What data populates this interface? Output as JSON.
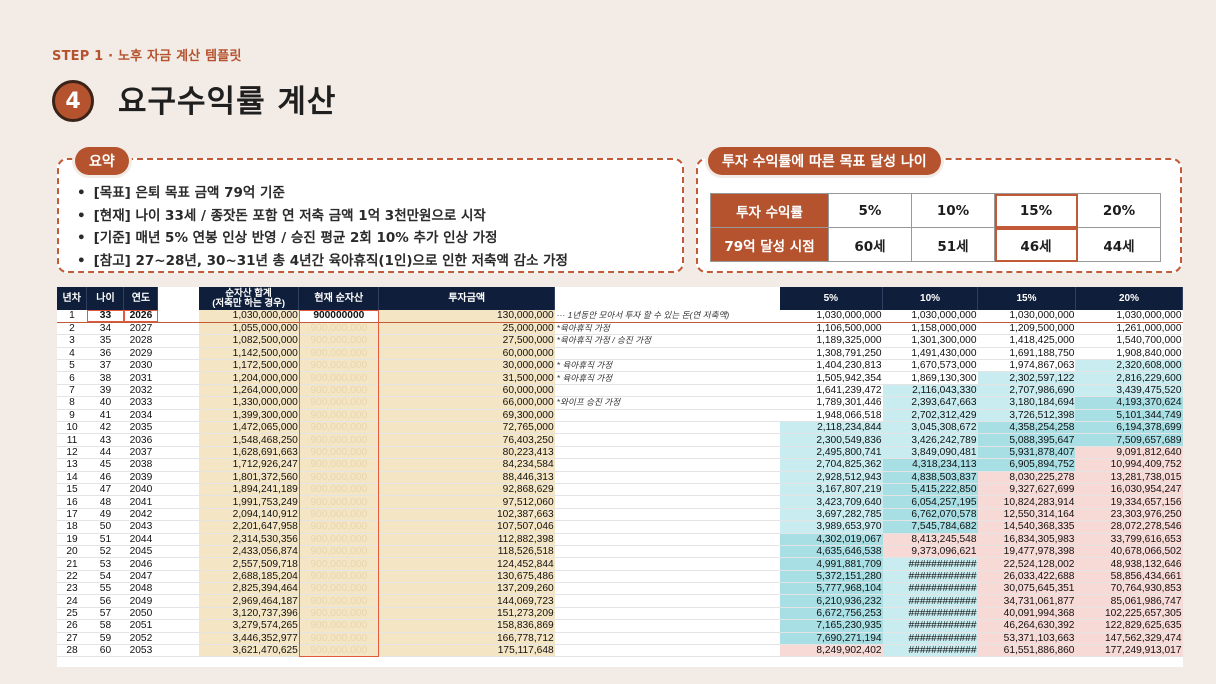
{
  "header": {
    "step": "STEP 1 · 노후 자금 계산 템플릿",
    "number": "4",
    "title": "요구수익률 계산"
  },
  "summary": {
    "label": "요약",
    "items": [
      "[목표] 은퇴 목표 금액 79억 기준",
      "[현재] 나이 33세 / 종잣돈 포함 연 저축 금액 1억 3천만원으로 시작",
      "[기준] 매년 5% 연봉 인상 반영 / 승진 평균 2회 10% 추가 인상 가정",
      "[참고] 27~28년, 30~31년 총 4년간 육아휴직(1인)으로 인한 저축액 감소 가정"
    ]
  },
  "target": {
    "label": "투자 수익률에 따른 목표 달성 나이",
    "row1_head": "투자 수익률",
    "row2_head": "79억 달성 시점",
    "rates": [
      "5%",
      "10%",
      "15%",
      "20%"
    ],
    "ages": [
      "60세",
      "51세",
      "46세",
      "44세"
    ],
    "highlight_index": 2
  },
  "sheet": {
    "headers": {
      "year_no": "년차",
      "age": "나이",
      "year": "연도",
      "net_sum": "순자산 합계\n(저축만 하는 경우)",
      "current": "현재 순자산",
      "invest": "투자금액",
      "r5": "5%",
      "r10": "10%",
      "r15": "15%",
      "r20": "20%"
    },
    "current_first": "900000000",
    "current_faded": "900,000,000",
    "rows": [
      [
        "1",
        "33",
        "2026",
        "1,030,000,000",
        "130,000,000",
        "··· 1년동안 모아서 투자 할 수 있는 돈(연 저축액)",
        "1,030,000,000",
        "1,030,000,000",
        "1,030,000,000",
        "1,030,000,000"
      ],
      [
        "2",
        "34",
        "2027",
        "1,055,000,000",
        "25,000,000",
        "*육아휴직 가정",
        "1,106,500,000",
        "1,158,000,000",
        "1,209,500,000",
        "1,261,000,000"
      ],
      [
        "3",
        "35",
        "2028",
        "1,082,500,000",
        "27,500,000",
        "*육아휴직 가정 / 승진 가정",
        "1,189,325,000",
        "1,301,300,000",
        "1,418,425,000",
        "1,540,700,000"
      ],
      [
        "4",
        "36",
        "2029",
        "1,142,500,000",
        "60,000,000",
        "",
        "1,308,791,250",
        "1,491,430,000",
        "1,691,188,750",
        "1,908,840,000"
      ],
      [
        "5",
        "37",
        "2030",
        "1,172,500,000",
        "30,000,000",
        "* 육아휴직 가정",
        "1,404,230,813",
        "1,670,573,000",
        "1,974,867,063",
        "2,320,608,000"
      ],
      [
        "6",
        "38",
        "2031",
        "1,204,000,000",
        "31,500,000",
        "* 육아휴직 가정",
        "1,505,942,354",
        "1,869,130,300",
        "2,302,597,122",
        "2,816,229,600"
      ],
      [
        "7",
        "39",
        "2032",
        "1,264,000,000",
        "60,000,000",
        "",
        "1,641,239,472",
        "2,116,043,330",
        "2,707,986,690",
        "3,439,475,520"
      ],
      [
        "8",
        "40",
        "2033",
        "1,330,000,000",
        "66,000,000",
        "*와이프 승진 가정",
        "1,789,301,446",
        "2,393,647,663",
        "3,180,184,694",
        "4,193,370,624"
      ],
      [
        "9",
        "41",
        "2034",
        "1,399,300,000",
        "69,300,000",
        "",
        "1,948,066,518",
        "2,702,312,429",
        "3,726,512,398",
        "5,101,344,749"
      ],
      [
        "10",
        "42",
        "2035",
        "1,472,065,000",
        "72,765,000",
        "",
        "2,118,234,844",
        "3,045,308,672",
        "4,358,254,258",
        "6,194,378,699"
      ],
      [
        "11",
        "43",
        "2036",
        "1,548,468,250",
        "76,403,250",
        "",
        "2,300,549,836",
        "3,426,242,789",
        "5,088,395,647",
        "7,509,657,689"
      ],
      [
        "12",
        "44",
        "2037",
        "1,628,691,663",
        "80,223,413",
        "",
        "2,495,800,741",
        "3,849,090,481",
        "5,931,878,407",
        "9,091,812,640"
      ],
      [
        "13",
        "45",
        "2038",
        "1,712,926,247",
        "84,234,584",
        "",
        "2,704,825,362",
        "4,318,234,113",
        "6,905,894,752",
        "10,994,409,752"
      ],
      [
        "14",
        "46",
        "2039",
        "1,801,372,560",
        "88,446,313",
        "",
        "2,928,512,943",
        "4,838,503,837",
        "8,030,225,278",
        "13,281,738,015"
      ],
      [
        "15",
        "47",
        "2040",
        "1,894,241,189",
        "92,868,629",
        "",
        "3,167,807,219",
        "5,415,222,850",
        "9,327,627,699",
        "16,030,954,247"
      ],
      [
        "16",
        "48",
        "2041",
        "1,991,753,249",
        "97,512,060",
        "",
        "3,423,709,640",
        "6,054,257,195",
        "10,824,283,914",
        "19,334,657,156"
      ],
      [
        "17",
        "49",
        "2042",
        "2,094,140,912",
        "102,387,663",
        "",
        "3,697,282,785",
        "6,762,070,578",
        "12,550,314,164",
        "23,303,976,250"
      ],
      [
        "18",
        "50",
        "2043",
        "2,201,647,958",
        "107,507,046",
        "",
        "3,989,653,970",
        "7,545,784,682",
        "14,540,368,335",
        "28,072,278,546"
      ],
      [
        "19",
        "51",
        "2044",
        "2,314,530,356",
        "112,882,398",
        "",
        "4,302,019,067",
        "8,413,245,548",
        "16,834,305,983",
        "33,799,616,653"
      ],
      [
        "20",
        "52",
        "2045",
        "2,433,056,874",
        "118,526,518",
        "",
        "4,635,646,538",
        "9,373,096,621",
        "19,477,978,398",
        "40,678,066,502"
      ],
      [
        "21",
        "53",
        "2046",
        "2,557,509,718",
        "124,452,844",
        "",
        "4,991,881,709",
        "############",
        "22,524,128,002",
        "48,938,132,646"
      ],
      [
        "22",
        "54",
        "2047",
        "2,688,185,204",
        "130,675,486",
        "",
        "5,372,151,280",
        "############",
        "26,033,422,688",
        "58,856,434,661"
      ],
      [
        "23",
        "55",
        "2048",
        "2,825,394,464",
        "137,209,260",
        "",
        "5,777,968,104",
        "############",
        "30,075,645,351",
        "70,764,930,853"
      ],
      [
        "24",
        "56",
        "2049",
        "2,969,464,187",
        "144,069,723",
        "",
        "6,210,936,232",
        "############",
        "34,731,061,877",
        "85,061,986,747"
      ],
      [
        "25",
        "57",
        "2050",
        "3,120,737,396",
        "151,273,209",
        "",
        "6,672,756,253",
        "############",
        "40,091,994,368",
        "102,225,657,305"
      ],
      [
        "26",
        "58",
        "2051",
        "3,279,574,265",
        "158,836,869",
        "",
        "7,165,230,935",
        "############",
        "46,264,630,392",
        "122,829,625,635"
      ],
      [
        "27",
        "59",
        "2052",
        "3,446,352,977",
        "166,778,712",
        "",
        "7,690,271,194",
        "############",
        "53,371,103,663",
        "147,562,329,474"
      ],
      [
        "28",
        "60",
        "2053",
        "3,621,470,625",
        "175,117,648",
        "",
        "8,249,902,402",
        "############",
        "61,551,886,860",
        "177,249,913,017"
      ]
    ]
  },
  "colors": {
    "accent": "#b5532f",
    "header_navy": "#0f1e3a",
    "tan": "#f4e5c4",
    "teal_light": "#c8ecef",
    "teal": "#a8dfe4",
    "pink": "#f7d9d6"
  }
}
